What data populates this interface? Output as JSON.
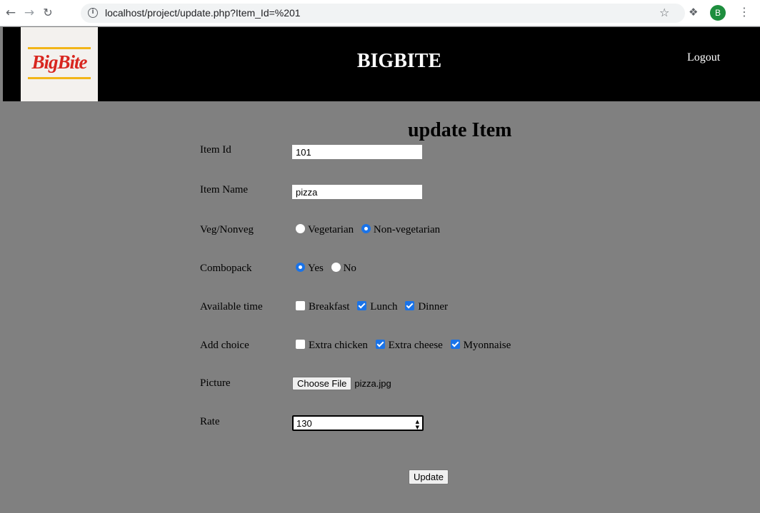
{
  "browser": {
    "back_icon": "arrow-left-icon",
    "forward_icon": "arrow-right-icon",
    "reload_icon": "reload-icon",
    "url": "localhost/project/update.php?Item_Id=%201",
    "profile_initial": "B"
  },
  "header": {
    "logo_text": "BigBite",
    "title": "BIGBITE",
    "logout": "Logout"
  },
  "form": {
    "heading": "update Item",
    "item_id": {
      "label": "Item Id",
      "value": "101"
    },
    "item_name": {
      "label": "Item Name",
      "value": "pizza"
    },
    "veg": {
      "label": "Veg/Nonveg",
      "options": [
        {
          "label": "Vegetarian",
          "checked": false
        },
        {
          "label": "Non-vegetarian",
          "checked": true
        }
      ]
    },
    "combo": {
      "label": "Combopack",
      "options": [
        {
          "label": "Yes",
          "checked": true
        },
        {
          "label": "No",
          "checked": false
        }
      ]
    },
    "time": {
      "label": "Available time",
      "options": [
        {
          "label": "Breakfast",
          "checked": false
        },
        {
          "label": "Lunch",
          "checked": true
        },
        {
          "label": "Dinner",
          "checked": true
        }
      ]
    },
    "choice": {
      "label": "Add choice",
      "options": [
        {
          "label": "Extra chicken",
          "checked": false
        },
        {
          "label": "Extra cheese",
          "checked": true
        },
        {
          "label": "Myonnaise",
          "checked": true
        }
      ]
    },
    "picture": {
      "label": "Picture",
      "button": "Choose File",
      "file_name": "pizza.jpg"
    },
    "rate": {
      "label": "Rate",
      "value": "130"
    },
    "submit": "Update"
  },
  "colors": {
    "page_bg": "#808080",
    "header_bg": "#000000",
    "accent": "#1a73e8",
    "logo_red": "#d8261f",
    "logo_yellow": "#f2b518"
  }
}
